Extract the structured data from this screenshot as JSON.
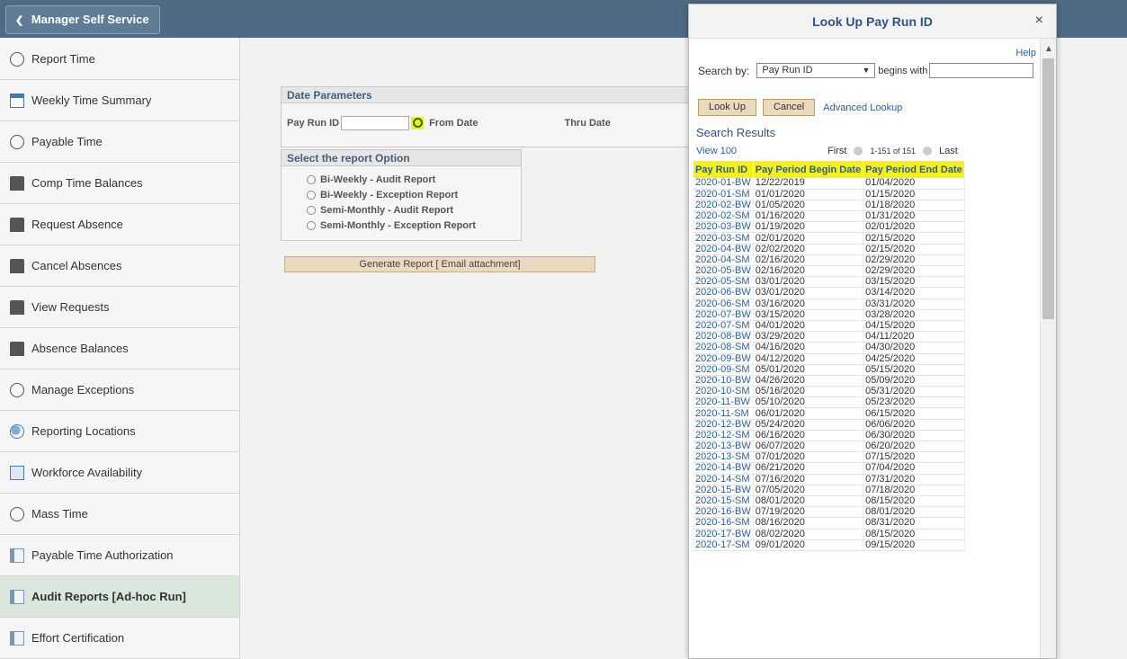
{
  "header": {
    "back_label": "Manager Self Service"
  },
  "sidebar": {
    "items": [
      {
        "label": "Report Time",
        "icon": "clock-icon"
      },
      {
        "label": "Weekly Time Summary",
        "icon": "calendar-icon"
      },
      {
        "label": "Payable Time",
        "icon": "payable-icon"
      },
      {
        "label": "Comp Time Balances",
        "icon": "people-icon"
      },
      {
        "label": "Request Absence",
        "icon": "people-icon"
      },
      {
        "label": "Cancel Absences",
        "icon": "people-icon"
      },
      {
        "label": "View Requests",
        "icon": "people-icon"
      },
      {
        "label": "Absence Balances",
        "icon": "people-icon"
      },
      {
        "label": "Manage Exceptions",
        "icon": "exception-icon"
      },
      {
        "label": "Reporting Locations",
        "icon": "globe-icon"
      },
      {
        "label": "Workforce Availability",
        "icon": "monitor-icon"
      },
      {
        "label": "Mass Time",
        "icon": "clock-icon"
      },
      {
        "label": "Payable Time Authorization",
        "icon": "document-icon"
      },
      {
        "label": "Audit Reports [Ad-hoc Run]",
        "icon": "document-icon"
      },
      {
        "label": "Effort Certification",
        "icon": "document-icon"
      }
    ]
  },
  "main": {
    "date_params_title": "Date Parameters",
    "pay_run_label": "Pay Run ID",
    "from_date_label": "From Date",
    "thru_date_label": "Thru Date",
    "report_option_title": "Select the report Option",
    "report_options": [
      "Bi-Weekly - Audit Report",
      "Bi-Weekly - Exception Report",
      "Semi-Monthly - Audit Report",
      "Semi-Monthly - Exception Report"
    ],
    "generate_label": "Generate Report [ Email attachment]"
  },
  "modal": {
    "title": "Look Up Pay Run ID",
    "close": "×",
    "help": "Help",
    "search_by_label": "Search by:",
    "search_by_value": "Pay Run ID",
    "begins_with": "begins with",
    "lookup_label": "Look Up",
    "cancel_label": "Cancel",
    "advanced_label": "Advanced Lookup",
    "results_title": "Search Results",
    "view_label": "View 100",
    "first_label": "First",
    "range_label": "1-151 of 151",
    "last_label": "Last",
    "columns": [
      "Pay Run ID",
      "Pay Period Begin Date",
      "Pay Period End Date"
    ],
    "rows": [
      [
        "2020-01-BW",
        "12/22/2019",
        "01/04/2020"
      ],
      [
        "2020-01-SM",
        "01/01/2020",
        "01/15/2020"
      ],
      [
        "2020-02-BW",
        "01/05/2020",
        "01/18/2020"
      ],
      [
        "2020-02-SM",
        "01/16/2020",
        "01/31/2020"
      ],
      [
        "2020-03-BW",
        "01/19/2020",
        "02/01/2020"
      ],
      [
        "2020-03-SM",
        "02/01/2020",
        "02/15/2020"
      ],
      [
        "2020-04-BW",
        "02/02/2020",
        "02/15/2020"
      ],
      [
        "2020-04-SM",
        "02/16/2020",
        "02/29/2020"
      ],
      [
        "2020-05-BW",
        "02/16/2020",
        "02/29/2020"
      ],
      [
        "2020-05-SM",
        "03/01/2020",
        "03/15/2020"
      ],
      [
        "2020-06-BW",
        "03/01/2020",
        "03/14/2020"
      ],
      [
        "2020-06-SM",
        "03/16/2020",
        "03/31/2020"
      ],
      [
        "2020-07-BW",
        "03/15/2020",
        "03/28/2020"
      ],
      [
        "2020-07-SM",
        "04/01/2020",
        "04/15/2020"
      ],
      [
        "2020-08-BW",
        "03/29/2020",
        "04/11/2020"
      ],
      [
        "2020-08-SM",
        "04/16/2020",
        "04/30/2020"
      ],
      [
        "2020-09-BW",
        "04/12/2020",
        "04/25/2020"
      ],
      [
        "2020-09-SM",
        "05/01/2020",
        "05/15/2020"
      ],
      [
        "2020-10-BW",
        "04/26/2020",
        "05/09/2020"
      ],
      [
        "2020-10-SM",
        "05/16/2020",
        "05/31/2020"
      ],
      [
        "2020-11-BW",
        "05/10/2020",
        "05/23/2020"
      ],
      [
        "2020-11-SM",
        "06/01/2020",
        "06/15/2020"
      ],
      [
        "2020-12-BW",
        "05/24/2020",
        "06/06/2020"
      ],
      [
        "2020-12-SM",
        "06/16/2020",
        "06/30/2020"
      ],
      [
        "2020-13-BW",
        "06/07/2020",
        "06/20/2020"
      ],
      [
        "2020-13-SM",
        "07/01/2020",
        "07/15/2020"
      ],
      [
        "2020-14-BW",
        "06/21/2020",
        "07/04/2020"
      ],
      [
        "2020-14-SM",
        "07/16/2020",
        "07/31/2020"
      ],
      [
        "2020-15-BW",
        "07/05/2020",
        "07/18/2020"
      ],
      [
        "2020-15-SM",
        "08/01/2020",
        "08/15/2020"
      ],
      [
        "2020-16-BW",
        "07/19/2020",
        "08/01/2020"
      ],
      [
        "2020-16-SM",
        "08/16/2020",
        "08/31/2020"
      ],
      [
        "2020-17-BW",
        "08/02/2020",
        "08/15/2020"
      ],
      [
        "2020-17-SM",
        "09/01/2020",
        "09/15/2020"
      ]
    ]
  }
}
